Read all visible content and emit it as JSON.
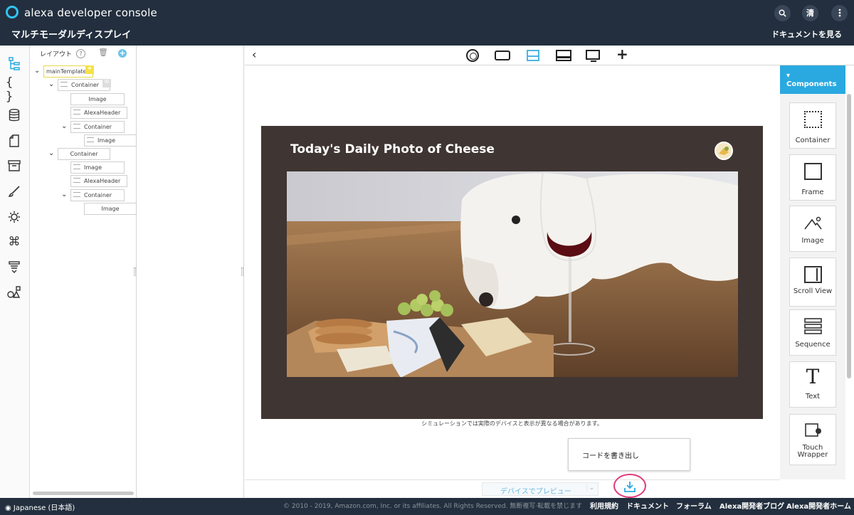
{
  "header": {
    "app_title": "alexa developer console",
    "page_name": "マルチモーダルディスプレイ",
    "docs_link": "ドキュメントを見る",
    "user_initial": "清",
    "brand_color": "#31c4f3",
    "bg_color": "#232f3e"
  },
  "rail": {
    "icons": [
      "layout-tree-icon",
      "braces-icon",
      "database-icon",
      "document-icon",
      "archive-icon",
      "brush-icon",
      "settings-sun-icon",
      "command-icon",
      "stack-icon",
      "shapes-icon"
    ]
  },
  "tree": {
    "title": "レイアウト",
    "help": "?",
    "nodes": {
      "root": "mainTemplate",
      "c1": "Container",
      "c1_image": "Image",
      "c1_header": "AlexaHeader",
      "c1_c": "Container",
      "c1_c_image": "Image",
      "c2": "Container",
      "c2_image": "Image",
      "c2_header": "AlexaHeader",
      "c2_c": "Container",
      "c2_c_image": "Image"
    }
  },
  "preview": {
    "heading": "Today's Daily Photo of Cheese",
    "sim_note": "シミュレーションでは実際のデバイスと表示が異なる場合があります。",
    "export_menu_item": "コードを書き出し",
    "preview_on_device": "デバイスでプレビュー",
    "selected_device": "medium-hub",
    "accent_color": "#4fb5e0",
    "highlight_color": "#e03a7d"
  },
  "components": {
    "title": "Components",
    "items": [
      "Container",
      "Frame",
      "Image",
      "Scroll View",
      "Sequence",
      "Text",
      "Touch Wrapper"
    ]
  },
  "footer": {
    "language": "Japanese (日本語)",
    "copyright": "© 2010 - 2019, Amazon.com, Inc. or its affiliates. All Rights Reserved. 無断複写·転載を禁じます",
    "links": [
      "利用規約",
      "ドキュメント",
      "フォーラム",
      "Alexa開発者ブログ",
      "Alexa開発者ホーム"
    ]
  }
}
